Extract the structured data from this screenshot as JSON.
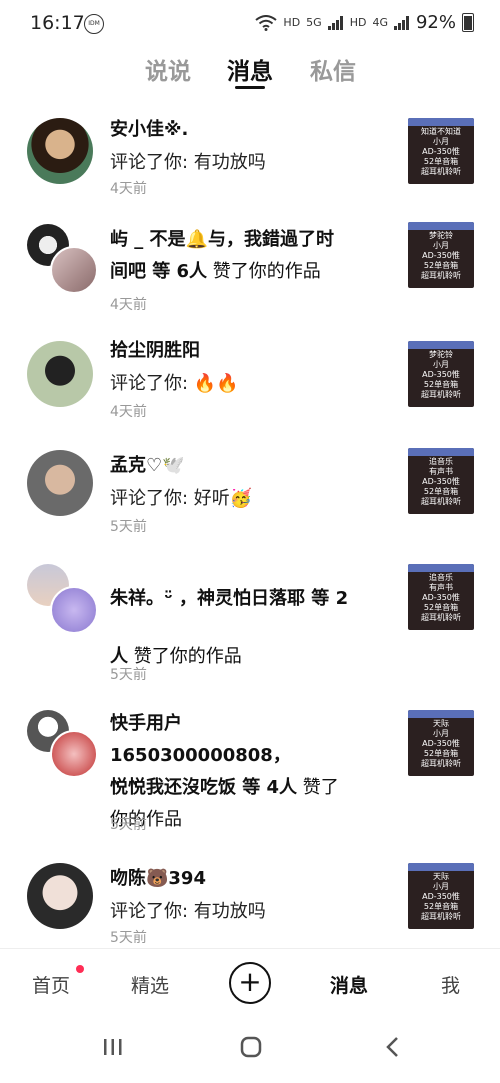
{
  "status": {
    "time": "16:17",
    "idm": "IDM",
    "hd1": "HD",
    "hd2": "HD",
    "net1": "5G",
    "net2": "4G",
    "battery": "92%"
  },
  "tabs": [
    {
      "label": "说说"
    },
    {
      "label": "消息"
    },
    {
      "label": "私信"
    }
  ],
  "messages": [
    {
      "title": "安小佳※.",
      "body": "评论了你: 有功放吗",
      "time": "4天前",
      "thumb": [
        "知道不知道",
        "小月",
        "AD-350惟",
        "52单音箱",
        "超耳机聆听"
      ]
    },
    {
      "title_line1": "屿 _ 不是🔔与，我錯過了时",
      "title_line2a": "间吧 等 6人",
      "title_line2b": " 赞了你的作品",
      "time": "4天前",
      "thumb": [
        "梦驼铃",
        "小月",
        "AD-350惟",
        "52单音箱",
        "超耳机聆听"
      ]
    },
    {
      "title": "拾尘阴胜阳",
      "body": "评论了你: 🔥🔥",
      "time": "4天前",
      "thumb": [
        "梦驼铃",
        "小月",
        "AD-350惟",
        "52单音箱",
        "超耳机聆听"
      ]
    },
    {
      "title": "孟克♡🕊️",
      "body": "评论了你: 好听🥳",
      "time": "5天前",
      "thumb": [
        "追音乐",
        "有声书",
        "AD-350惟",
        "52单音箱",
        "超耳机聆听"
      ]
    },
    {
      "title_line1": "朱祥。ᵕ̈ ，神灵怕日落耶 等 2",
      "title_line2a": "人",
      "title_line2b": " 赞了你的作品",
      "time": "5天前",
      "thumb": [
        "追音乐",
        "有声书",
        "AD-350惟",
        "52单音箱",
        "超耳机聆听"
      ]
    },
    {
      "title_line1": "快手用户1650300000808，",
      "title_line2a": "悦悦我还沒吃饭 等 4人",
      "title_line2b": " 赞了",
      "title_line3": "你的作品",
      "time": "5天前",
      "thumb": [
        "天际",
        "小月",
        "AD-350惟",
        "52单音箱",
        "超耳机聆听"
      ]
    },
    {
      "title": "吻陈🐻394",
      "body": "评论了你: 有功放吗",
      "time": "5天前",
      "thumb": [
        "天际",
        "小月",
        "AD-350惟",
        "52单音箱",
        "超耳机聆听"
      ]
    }
  ],
  "nav": {
    "home": "首页",
    "featured": "精选",
    "plus": "+",
    "messages": "消息",
    "me": "我"
  },
  "sysnav": {
    "recents": "|||",
    "home": "○",
    "back": "<"
  }
}
